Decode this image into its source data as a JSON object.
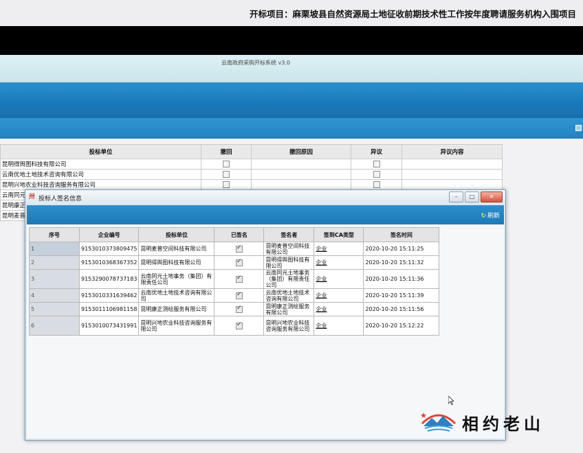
{
  "header": {
    "project_title": "开标项目：麻栗坡县自然资源局土地征收前期技术性工作按年度聘请服务机构入围项目",
    "system_title": "云南政府采购开标系统 v3.0"
  },
  "bidder_table": {
    "columns": [
      "投标单位",
      "撤回",
      "撤回原因",
      "异议",
      "异议内容"
    ],
    "rows": [
      {
        "name": "昆明得舆图科技有限公司"
      },
      {
        "name": "云南优地土地技术咨询有限公司"
      },
      {
        "name": "昆明兴地农业科技咨询服务有限公司"
      },
      {
        "name": "云南同元"
      },
      {
        "name": "昆明康正"
      },
      {
        "name": "昆明麦普"
      }
    ]
  },
  "dialog": {
    "title": "投标人签名信息",
    "refresh_label": "刷新",
    "columns": [
      "序号",
      "企业编号",
      "投标单位",
      "已签名",
      "签名者",
      "签到CA类型",
      "签名时间"
    ],
    "rows": [
      {
        "idx": "1",
        "code": "9153010373809475",
        "unit": "昆明麦普空间科技有限公司",
        "signed": true,
        "signer": "昆明麦普空间科技有限公司",
        "ca_type": "企业",
        "time": "2020-10-20  15:11:25"
      },
      {
        "idx": "2",
        "code": "9153010368367352",
        "unit": "昆明得舆图科技有限公司",
        "signed": true,
        "signer": "昆明得舆图科技有限公司",
        "ca_type": "企业",
        "time": "2020-10-20  15:11:32"
      },
      {
        "idx": "3",
        "code": "9153290078737183",
        "unit": "云南同元土地事务（集团）有限责任公司",
        "signed": true,
        "signer": "云南同元土地事务（集团）有限责任公司",
        "ca_type": "企业",
        "time": "2020-10-20  15:11:36"
      },
      {
        "idx": "4",
        "code": "9153010331639462",
        "unit": "云南优地土地技术咨询有限公司",
        "signed": true,
        "signer": "云南优地土地技术咨询有限公司",
        "ca_type": "企业",
        "time": "2020-10-20  15:11:39"
      },
      {
        "idx": "5",
        "code": "9153011106981158",
        "unit": "昆明康正测绘服务有限公司",
        "signed": true,
        "signer": "昆明康正测绘服务有限公司",
        "ca_type": "企业",
        "time": "2020-10-20  15:11:56"
      },
      {
        "idx": "6",
        "code": "9153010073431991",
        "unit": "昆明兴地农业科技咨询服务有限公司",
        "signed": true,
        "signer": "昆明兴地农业科技咨询服务有限公司",
        "ca_type": "企业",
        "time": "2020-10-20  15:12:22"
      }
    ]
  },
  "watermark": {
    "brand_text": "相约老山",
    "logo_icon": "mountain-logo-icon"
  },
  "colors": {
    "header_blue": "#1979b9",
    "dialog_toolbar_blue": "#1c79b6",
    "close_red": "#d9503b"
  }
}
